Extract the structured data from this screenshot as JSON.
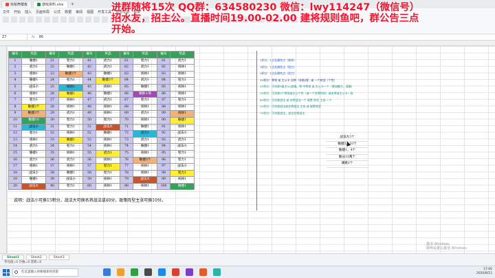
{
  "tabs": [
    {
      "label": "找稻壳模板",
      "color": "#e8453c",
      "active": false
    },
    {
      "label": "游戏资料.xlsx",
      "color": "#1d8a3f",
      "active": true
    }
  ],
  "ribbon": {
    "menu": [
      "文件",
      "开始",
      "插入",
      "页面布局",
      "公式",
      "数据",
      "审阅",
      "视图",
      "开发工具",
      "会员专享",
      "效率"
    ]
  },
  "formula_bar": {
    "cell": "Z7",
    "value": "86"
  },
  "banner": "进群随将15次 QQ群：634580230 微信：lwy114247（微信号）招水友，招主公。直播时间19.00-02.00 建将规则鱼吧，群公告三点开始。",
  "table": {
    "headers": [
      "编号",
      "奖品",
      "编号",
      "奖品",
      "编号",
      "奖品",
      "编号",
      "奖品",
      "编号",
      "奖品"
    ],
    "rows": [
      [
        "1",
        "敏捷1",
        "21",
        "智力1",
        "41",
        "武力1",
        "61",
        "智力1",
        "81",
        "武力1"
      ],
      [
        "2",
        "武力1",
        "22",
        "敏捷1",
        "42",
        "武力1",
        "62",
        "武力1",
        "82",
        "统帅1"
      ],
      [
        "3",
        "统帅1",
        "23",
        "敏捷3个",
        "43",
        "敏捷1",
        "63",
        "统帅1",
        "83",
        "统帅1"
      ],
      [
        "4",
        "敏捷1",
        "24",
        "智力1",
        "44",
        "敏捷3个",
        "64",
        "武力1",
        "84",
        "智力1"
      ],
      [
        "5",
        "战法小",
        "25",
        "统帅1",
        "45",
        "统帅1",
        "65",
        "敏捷1",
        "85",
        "统帅1"
      ],
      [
        "6",
        "统帅1",
        "26",
        "敏捷1",
        "46",
        "敏捷1",
        "66",
        "驿路十券",
        "86",
        "统帅1"
      ],
      [
        "7",
        "智力1",
        "27",
        "统帅1",
        "47",
        "武力1",
        "67",
        "智力1",
        "87",
        "智力1"
      ],
      [
        "8",
        "敏捷3个",
        "28",
        "统帅1",
        "48",
        "统帅1",
        "68",
        "统帅1",
        "88",
        "统帅1"
      ],
      [
        "9",
        "敏捷3个",
        "29",
        "武力1",
        "49",
        "统帅1",
        "69",
        "武力1",
        "89",
        "统帅1"
      ],
      [
        "10",
        "敏捷10",
        "30",
        "智力1",
        "50",
        "智力1",
        "70",
        "统帅1",
        "90",
        "敏捷1"
      ],
      [
        "11",
        "战法小",
        "31",
        "智力1",
        "51",
        "战法大",
        "71",
        "敏捷1",
        "91",
        "统帅1"
      ],
      [
        "12",
        "智力1",
        "32",
        "统帅1",
        "52",
        "敏捷1",
        "72",
        "武力1",
        "92",
        "战法小"
      ],
      [
        "13",
        "统帅1",
        "33",
        "敏捷1",
        "53",
        "统帅1",
        "73",
        "武力1",
        "93",
        "武力1"
      ],
      [
        "14",
        "武力1",
        "34",
        "智力1",
        "54",
        "统帅1",
        "74",
        "敏捷1",
        "94",
        "战法小"
      ],
      [
        "15",
        "敏捷1",
        "35",
        "统帅1",
        "55",
        "武力1",
        "75",
        "统帅1",
        "95",
        "智力1"
      ],
      [
        "16",
        "武力1",
        "36",
        "武力1",
        "56",
        "统帅1",
        "76",
        "敏捷3个",
        "96",
        "智力1"
      ],
      [
        "17",
        "统帅1",
        "37",
        "统帅1",
        "57",
        "智力1",
        "77",
        "统帅1",
        "97",
        "战法小"
      ],
      [
        "18",
        "战法小",
        "38",
        "敏捷1",
        "58",
        "智力1",
        "78",
        "统帅1",
        "98",
        "智力1"
      ],
      [
        "19",
        "敏捷1",
        "39",
        "战法小",
        "59",
        "统帅1",
        "79",
        "战法大",
        "99",
        "统帅1"
      ],
      [
        "20",
        "战法大",
        "40",
        "智力1",
        "60",
        "统帅1",
        "80",
        "统帅1",
        "100",
        "敏捷1"
      ]
    ],
    "highlights": [
      {
        "row": 3,
        "col": 3,
        "color": "#f2b07a"
      },
      {
        "row": 4,
        "col": 5,
        "color": "#ffee33"
      },
      {
        "row": 5,
        "col": 3,
        "color": "#2db5d6"
      },
      {
        "row": 6,
        "col": 3,
        "color": "#ffee33"
      },
      {
        "row": 6,
        "col": 7,
        "color": "#a04bb0"
      },
      {
        "row": 8,
        "col": 1,
        "color": "#ffee33"
      },
      {
        "row": 9,
        "col": 1,
        "color": "#f2b07a"
      },
      {
        "row": 9,
        "col": 9,
        "color": "#f2b07a"
      },
      {
        "row": 10,
        "col": 1,
        "color": "#33a35a"
      },
      {
        "row": 10,
        "col": 9,
        "color": "#ffee33"
      },
      {
        "row": 11,
        "col": 1,
        "color": "#2db5d6"
      },
      {
        "row": 11,
        "col": 5,
        "color": "#c8542c"
      },
      {
        "row": 12,
        "col": 7,
        "color": "#2db5d6"
      },
      {
        "row": 13,
        "col": 3,
        "color": "#ffee33"
      },
      {
        "row": 15,
        "col": 5,
        "color": "#ffee33"
      },
      {
        "row": 16,
        "col": 7,
        "color": "#f2b07a"
      },
      {
        "row": 17,
        "col": 5,
        "color": "#ffee33"
      },
      {
        "row": 18,
        "col": 9,
        "color": "#ffee33"
      },
      {
        "row": 19,
        "col": 7,
        "color": "#c8542c"
      },
      {
        "row": 20,
        "col": 1,
        "color": "#c8542c"
      },
      {
        "row": 20,
        "col": 9,
        "color": "#33a35a"
      }
    ]
  },
  "note": "说明：战法小可换15积分，战法大可换名将战法或40分，政策阵型主张可换10分。",
  "right_lines": [
    {
      "text": "1积分：1点兵属性点（统率）",
      "color": "#2a62c8"
    },
    {
      "text": "3积分：1点兵属性点（智力）",
      "color": "#2a62c8"
    },
    {
      "text": "5积分：1点兵属性点（武力）",
      "color": "#2a62c8"
    },
    {
      "text": "10积分：将领 或 主公卡 兵种（非限/限）或 一个转战（个性）",
      "color": "#1e3c8c"
    },
    {
      "text": "20积分：可兑换1级主公/战魂。将 中将领 或 主公卡一个（增加魅力、谋略）",
      "color": "#1f8a7a"
    },
    {
      "text": "30积分：可兑换1个将领或主公个性（或一个名将特技）或名将或主公卡一张",
      "color": "#1f8a7a"
    },
    {
      "text": "40积分：可兑换战法 或 名将战法一个 政策 阵型 主张 一个",
      "color": "#1f8a7a"
    },
    {
      "text": "50积分：可兑换战法或名将战法 主张 或 政策阵型",
      "color": "#1f8a7a"
    },
    {
      "text": "70积分：可兑换战法，战法名将战法",
      "color": "#1f8a7a"
    }
  ],
  "stats": [
    "战法大3个",
    "敏捷3，10个",
    "敏捷1，4个",
    "敏分31两个",
    "驿路1个"
  ],
  "sheet_tabs": [
    "Sheet1",
    "Sheet2",
    "Sheet3"
  ],
  "status_text": "平均值=0  计数=0  求和=0",
  "watermark": [
    "激活 Windows",
    "转到设置以激活 Windows"
  ],
  "taskbar": {
    "search_placeholder": "在这里输入你要搜索的内容",
    "icon_colors": [
      "#3a7bd5",
      "#f0a030",
      "#2f9e44",
      "#4a4a4a",
      "#1e88e5",
      "#d9412f",
      "#7a3fc4",
      "#e25c2c",
      "#2bb4a6"
    ],
    "time": "17:00",
    "date": "2020/8/11"
  }
}
